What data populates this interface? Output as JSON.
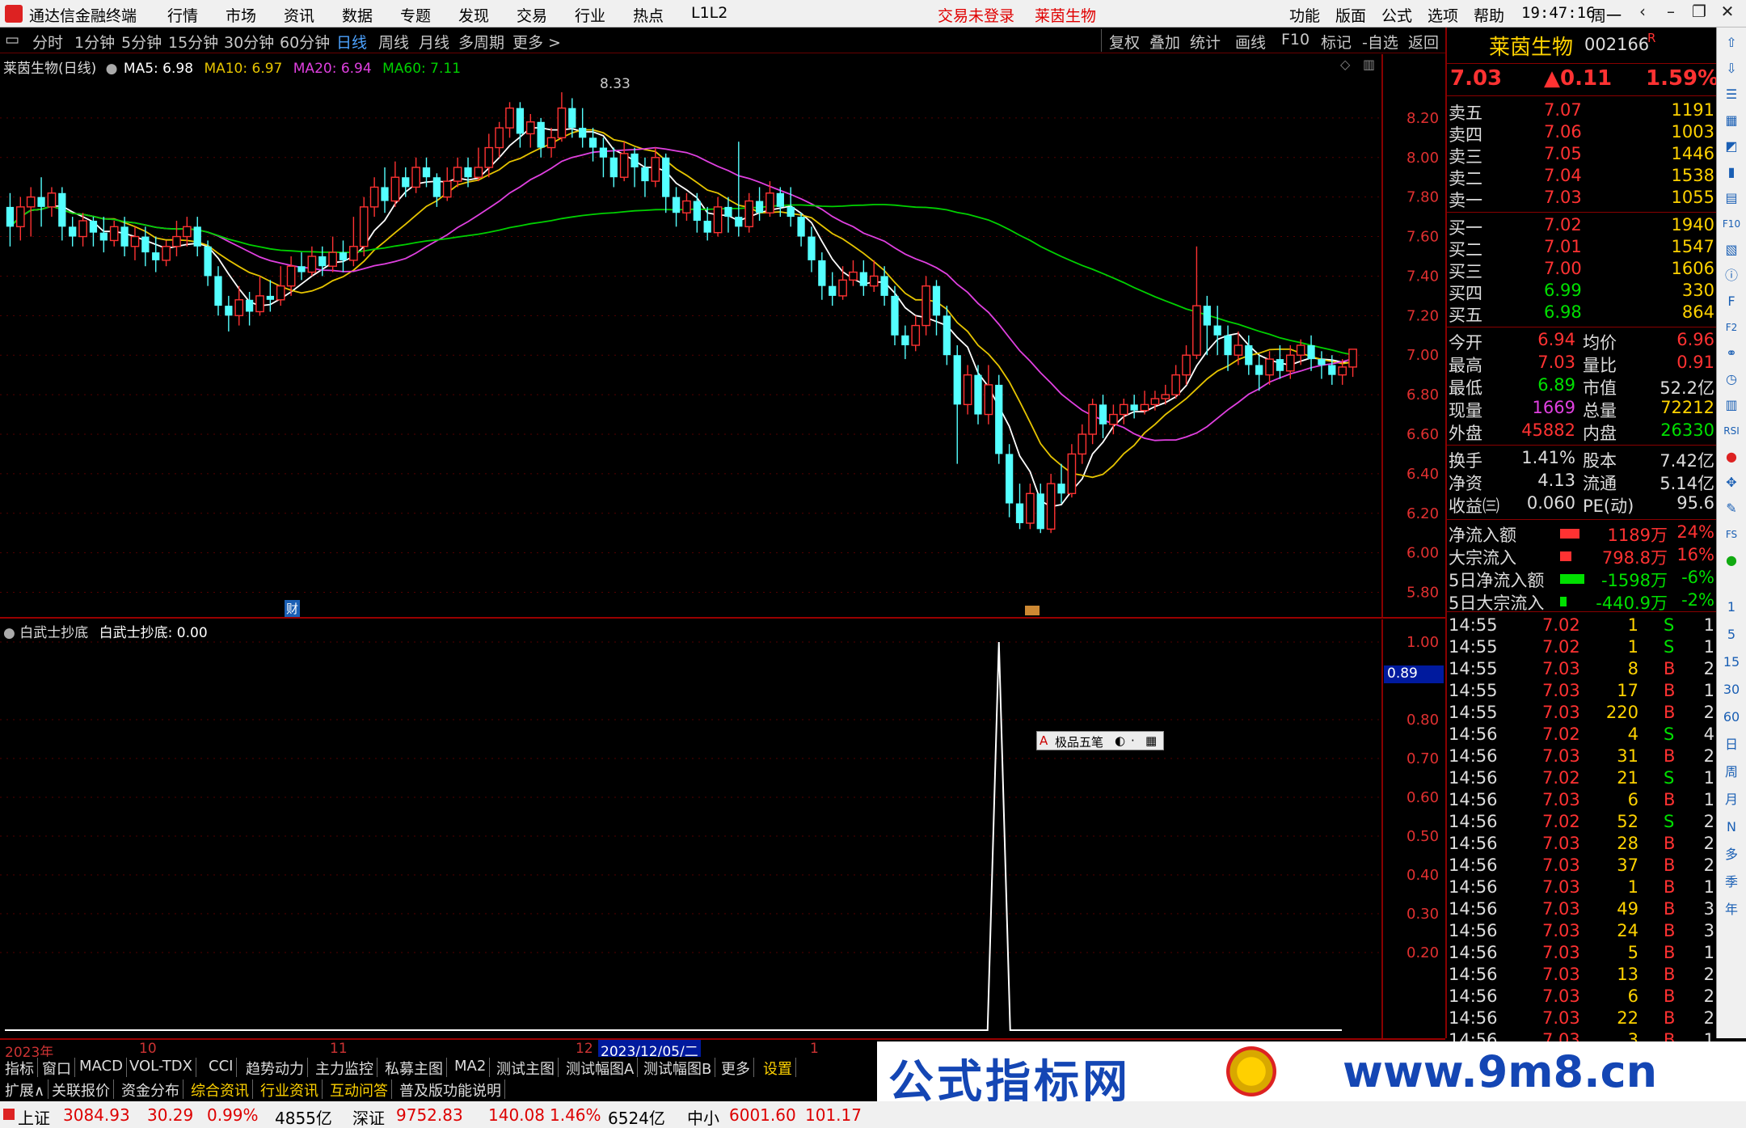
{
  "app": {
    "title": "通达信金融终端",
    "menu": [
      "行情",
      "市场",
      "资讯",
      "数据",
      "专题",
      "发现",
      "交易",
      "行业",
      "热点",
      "L1L2"
    ],
    "center_status": "交易未登录",
    "center_stock": "莱茵生物",
    "right_menu": [
      "功能",
      "版面",
      "公式",
      "选项",
      "帮助"
    ],
    "clock": "19:47:16",
    "weekday": "周一"
  },
  "periods": [
    "分时",
    "1分钟",
    "5分钟",
    "15分钟",
    "30分钟",
    "60分钟",
    "日线",
    "周线",
    "月线",
    "多周期",
    "更多 >"
  ],
  "selected_period": "日线",
  "chart_tools": [
    "复权",
    "叠加",
    "统计",
    "画线",
    "F10",
    "标记",
    "-自选",
    "返回"
  ],
  "main_legend": {
    "name": "莱茵生物(日线)",
    "ma5": "MA5: 6.98",
    "ma10": "MA10: 6.97",
    "ma20": "MA20: 6.94",
    "ma60": "MA60: 7.11"
  },
  "indicator_legend": {
    "name": "白武士抄底",
    "value": "白武士抄底: 0.00"
  },
  "high_marker": "8.33",
  "fin_marker": "财",
  "pop_tool": "极品五笔",
  "axis_value": "0.89",
  "date_axis": {
    "year": "2023年",
    "m10": "10",
    "m11": "11",
    "m12": "12",
    "cursor": "2023/12/05/二",
    "n1": "1"
  },
  "colors": {
    "up": "#ff3232",
    "down": "#54ffff",
    "ma5": "#ffffff",
    "ma10": "#e6c400",
    "ma20": "#e040e0",
    "ma60": "#00d000"
  },
  "chart_data": [
    {
      "type": "candlestick",
      "title": "莱茵生物(日线)",
      "y_ticks": [
        "8.20",
        "8.00",
        "7.80",
        "7.60",
        "7.40",
        "7.20",
        "7.00",
        "6.80",
        "6.60",
        "6.40",
        "6.20",
        "6.00",
        "5.80"
      ],
      "ylim": [
        5.7,
        8.4
      ],
      "candles": [
        [
          7.75,
          7.65,
          7.82,
          7.55
        ],
        [
          7.65,
          7.75,
          7.8,
          7.58
        ],
        [
          7.75,
          7.8,
          7.85,
          7.6
        ],
        [
          7.8,
          7.75,
          7.9,
          7.65
        ],
        [
          7.75,
          7.82,
          7.85,
          7.7
        ],
        [
          7.82,
          7.65,
          7.85,
          7.58
        ],
        [
          7.65,
          7.6,
          7.7,
          7.55
        ],
        [
          7.6,
          7.68,
          7.72,
          7.55
        ],
        [
          7.68,
          7.62,
          7.7,
          7.55
        ],
        [
          7.62,
          7.58,
          7.7,
          7.52
        ],
        [
          7.58,
          7.65,
          7.68,
          7.55
        ],
        [
          7.65,
          7.55,
          7.7,
          7.5
        ],
        [
          7.55,
          7.6,
          7.65,
          7.48
        ],
        [
          7.6,
          7.52,
          7.65,
          7.45
        ],
        [
          7.52,
          7.48,
          7.6,
          7.42
        ],
        [
          7.48,
          7.55,
          7.58,
          7.45
        ],
        [
          7.55,
          7.6,
          7.68,
          7.5
        ],
        [
          7.6,
          7.65,
          7.7,
          7.55
        ],
        [
          7.65,
          7.55,
          7.7,
          7.5
        ],
        [
          7.55,
          7.4,
          7.58,
          7.35
        ],
        [
          7.4,
          7.25,
          7.45,
          7.2
        ],
        [
          7.25,
          7.2,
          7.3,
          7.12
        ],
        [
          7.2,
          7.28,
          7.35,
          7.15
        ],
        [
          7.28,
          7.22,
          7.32,
          7.15
        ],
        [
          7.22,
          7.3,
          7.4,
          7.2
        ],
        [
          7.3,
          7.28,
          7.38,
          7.22
        ],
        [
          7.28,
          7.35,
          7.45,
          7.25
        ],
        [
          7.35,
          7.45,
          7.5,
          7.3
        ],
        [
          7.45,
          7.42,
          7.52,
          7.38
        ],
        [
          7.42,
          7.5,
          7.55,
          7.4
        ],
        [
          7.5,
          7.45,
          7.55,
          7.4
        ],
        [
          7.45,
          7.52,
          7.6,
          7.42
        ],
        [
          7.52,
          7.48,
          7.58,
          7.42
        ],
        [
          7.48,
          7.55,
          7.7,
          7.45
        ],
        [
          7.55,
          7.75,
          7.8,
          7.5
        ],
        [
          7.75,
          7.85,
          7.9,
          7.7
        ],
        [
          7.85,
          7.78,
          7.95,
          7.72
        ],
        [
          7.78,
          7.9,
          7.98,
          7.75
        ],
        [
          7.9,
          7.85,
          7.95,
          7.8
        ],
        [
          7.85,
          7.95,
          8.0,
          7.82
        ],
        [
          7.95,
          7.9,
          8.0,
          7.85
        ],
        [
          7.9,
          7.8,
          7.92,
          7.75
        ],
        [
          7.8,
          7.88,
          7.95,
          7.78
        ],
        [
          7.88,
          7.95,
          8.0,
          7.85
        ],
        [
          7.95,
          7.9,
          8.0,
          7.85
        ],
        [
          7.9,
          7.95,
          8.05,
          7.88
        ],
        [
          7.95,
          8.05,
          8.12,
          7.9
        ],
        [
          8.05,
          8.15,
          8.18,
          8.0
        ],
        [
          8.15,
          8.25,
          8.28,
          8.1
        ],
        [
          8.25,
          8.12,
          8.28,
          8.05
        ],
        [
          8.12,
          8.18,
          8.22,
          8.05
        ],
        [
          8.18,
          8.05,
          8.2,
          8.0
        ],
        [
          8.05,
          8.1,
          8.15,
          8.0
        ],
        [
          8.1,
          8.25,
          8.33,
          8.08
        ],
        [
          8.25,
          8.15,
          8.3,
          8.1
        ],
        [
          8.15,
          8.1,
          8.25,
          8.05
        ],
        [
          8.1,
          8.05,
          8.15,
          7.98
        ],
        [
          8.05,
          8.0,
          8.1,
          7.9
        ],
        [
          8.0,
          7.9,
          8.05,
          7.85
        ],
        [
          7.9,
          8.02,
          8.08,
          7.88
        ],
        [
          8.02,
          7.95,
          8.05,
          7.85
        ],
        [
          7.95,
          7.88,
          8.0,
          7.8
        ],
        [
          7.88,
          8.0,
          8.05,
          7.85
        ],
        [
          8.0,
          7.8,
          8.02,
          7.72
        ],
        [
          7.8,
          7.72,
          7.85,
          7.65
        ],
        [
          7.72,
          7.78,
          7.82,
          7.68
        ],
        [
          7.78,
          7.68,
          7.82,
          7.62
        ],
        [
          7.68,
          7.62,
          7.75,
          7.58
        ],
        [
          7.62,
          7.75,
          7.8,
          7.6
        ],
        [
          7.75,
          7.7,
          7.8,
          7.62
        ],
        [
          7.7,
          7.65,
          8.08,
          7.6
        ],
        [
          7.65,
          7.78,
          7.82,
          7.62
        ],
        [
          7.78,
          7.72,
          7.85,
          7.68
        ],
        [
          7.72,
          7.82,
          7.88,
          7.7
        ],
        [
          7.82,
          7.75,
          7.85,
          7.7
        ],
        [
          7.75,
          7.7,
          7.85,
          7.65
        ],
        [
          7.7,
          7.6,
          7.72,
          7.55
        ],
        [
          7.6,
          7.48,
          7.65,
          7.42
        ],
        [
          7.48,
          7.35,
          7.52,
          7.28
        ],
        [
          7.35,
          7.3,
          7.42,
          7.25
        ],
        [
          7.3,
          7.38,
          7.45,
          7.28
        ],
        [
          7.38,
          7.42,
          7.48,
          7.35
        ],
        [
          7.42,
          7.35,
          7.48,
          7.3
        ],
        [
          7.35,
          7.4,
          7.48,
          7.32
        ],
        [
          7.4,
          7.3,
          7.45,
          7.25
        ],
        [
          7.3,
          7.1,
          7.35,
          7.05
        ],
        [
          7.1,
          7.05,
          7.15,
          6.98
        ],
        [
          7.05,
          7.15,
          7.2,
          7.02
        ],
        [
          7.15,
          7.35,
          7.4,
          7.1
        ],
        [
          7.35,
          7.2,
          7.38,
          7.1
        ],
        [
          7.2,
          7.0,
          7.25,
          6.95
        ],
        [
          7.0,
          6.75,
          7.05,
          6.45
        ],
        [
          6.75,
          6.9,
          6.95,
          6.7
        ],
        [
          6.9,
          6.7,
          6.95,
          6.65
        ],
        [
          6.7,
          6.85,
          6.95,
          6.65
        ],
        [
          6.85,
          6.5,
          6.9,
          6.45
        ],
        [
          6.5,
          6.25,
          6.55,
          6.18
        ],
        [
          6.25,
          6.15,
          6.35,
          6.12
        ],
        [
          6.15,
          6.3,
          6.35,
          6.12
        ],
        [
          6.3,
          6.12,
          6.35,
          6.1
        ],
        [
          6.12,
          6.35,
          6.4,
          6.1
        ],
        [
          6.35,
          6.3,
          6.45,
          6.25
        ],
        [
          6.3,
          6.5,
          6.55,
          6.28
        ],
        [
          6.5,
          6.6,
          6.65,
          6.45
        ],
        [
          6.6,
          6.75,
          6.78,
          6.55
        ],
        [
          6.75,
          6.65,
          6.8,
          6.58
        ],
        [
          6.65,
          6.7,
          6.75,
          6.6
        ],
        [
          6.7,
          6.75,
          6.78,
          6.65
        ],
        [
          6.75,
          6.72,
          6.8,
          6.68
        ],
        [
          6.72,
          6.75,
          6.82,
          6.7
        ],
        [
          6.75,
          6.78,
          6.82,
          6.72
        ],
        [
          6.78,
          6.8,
          6.85,
          6.75
        ],
        [
          6.8,
          6.9,
          6.95,
          6.78
        ],
        [
          6.9,
          7.0,
          7.05,
          6.85
        ],
        [
          7.0,
          7.25,
          7.55,
          6.98
        ],
        [
          7.25,
          7.15,
          7.3,
          7.0
        ],
        [
          7.15,
          7.1,
          7.25,
          7.0
        ],
        [
          7.1,
          7.0,
          7.15,
          6.92
        ],
        [
          7.0,
          7.05,
          7.12,
          6.95
        ],
        [
          7.05,
          6.95,
          7.1,
          6.9
        ],
        [
          6.95,
          6.9,
          7.0,
          6.82
        ],
        [
          6.9,
          6.98,
          7.02,
          6.85
        ],
        [
          6.98,
          6.92,
          7.05,
          6.88
        ],
        [
          6.92,
          7.0,
          7.05,
          6.88
        ],
        [
          7.0,
          7.05,
          7.08,
          6.95
        ],
        [
          7.05,
          6.98,
          7.1,
          6.92
        ],
        [
          6.98,
          6.95,
          7.02,
          6.88
        ],
        [
          6.95,
          6.9,
          7.0,
          6.85
        ],
        [
          6.9,
          6.94,
          6.98,
          6.85
        ],
        [
          6.94,
          7.03,
          7.03,
          6.89
        ]
      ]
    },
    {
      "type": "line",
      "title": "白武士抄底",
      "y_ticks": [
        "1.00",
        "0.80",
        "0.70",
        "0.60",
        "0.50",
        "0.40",
        "0.30",
        "0.20"
      ],
      "ylim": [
        0,
        1.0
      ],
      "spike_index": 95,
      "spike_value": 1.0
    }
  ],
  "quote": {
    "name": "莱茵生物",
    "code": "002166",
    "flag": "R",
    "price": "7.03",
    "change": "▲0.11",
    "pct": "1.59%",
    "asks": [
      [
        "卖五",
        "7.07",
        "1191"
      ],
      [
        "卖四",
        "7.06",
        "1003"
      ],
      [
        "卖三",
        "7.05",
        "1446"
      ],
      [
        "卖二",
        "7.04",
        "1538"
      ],
      [
        "卖一",
        "7.03",
        "1055"
      ]
    ],
    "bids": [
      [
        "买一",
        "7.02",
        "1940"
      ],
      [
        "买二",
        "7.01",
        "1547"
      ],
      [
        "买三",
        "7.00",
        "1606"
      ],
      [
        "买四",
        "6.99",
        "330"
      ],
      [
        "买五",
        "6.98",
        "864"
      ]
    ],
    "stats": [
      [
        "今开",
        "6.94",
        "均价",
        "6.96"
      ],
      [
        "最高",
        "7.03",
        "量比",
        "0.91"
      ],
      [
        "最低",
        "6.89",
        "市值",
        "52.2亿"
      ],
      [
        "现量",
        "1669",
        "总量",
        "72212"
      ],
      [
        "外盘",
        "45882",
        "内盘",
        "26330"
      ]
    ],
    "stats2": [
      [
        "换手",
        "1.41%",
        "股本",
        "7.42亿"
      ],
      [
        "净资",
        "4.13",
        "流通",
        "5.14亿"
      ],
      [
        "收益㈢",
        "0.060",
        "PE(动)",
        "95.6"
      ]
    ],
    "flows": [
      [
        "净流入额",
        "1189万",
        "24%"
      ],
      [
        "大宗流入",
        "798.8万",
        "16%"
      ],
      [
        "5日净流入额",
        "-1598万",
        "-6%"
      ],
      [
        "5日大宗流入",
        "-440.9万",
        "-2%"
      ]
    ]
  },
  "ticks": [
    [
      "14:55",
      "7.02",
      "1",
      "S",
      "1"
    ],
    [
      "14:55",
      "7.02",
      "1",
      "S",
      "1"
    ],
    [
      "14:55",
      "7.03",
      "8",
      "B",
      "2"
    ],
    [
      "14:55",
      "7.03",
      "17",
      "B",
      "1"
    ],
    [
      "14:55",
      "7.03",
      "220",
      "B",
      "2"
    ],
    [
      "14:56",
      "7.02",
      "4",
      "S",
      "4"
    ],
    [
      "14:56",
      "7.03",
      "31",
      "B",
      "2"
    ],
    [
      "14:56",
      "7.02",
      "21",
      "S",
      "1"
    ],
    [
      "14:56",
      "7.03",
      "6",
      "B",
      "1"
    ],
    [
      "14:56",
      "7.02",
      "52",
      "S",
      "2"
    ],
    [
      "14:56",
      "7.03",
      "28",
      "B",
      "2"
    ],
    [
      "14:56",
      "7.03",
      "37",
      "B",
      "2"
    ],
    [
      "14:56",
      "7.03",
      "1",
      "B",
      "1"
    ],
    [
      "14:56",
      "7.03",
      "49",
      "B",
      "3"
    ],
    [
      "14:56",
      "7.03",
      "24",
      "B",
      "3"
    ],
    [
      "14:56",
      "7.03",
      "5",
      "B",
      "1"
    ],
    [
      "14:56",
      "7.03",
      "13",
      "B",
      "2"
    ],
    [
      "14:56",
      "7.03",
      "6",
      "B",
      "2"
    ],
    [
      "14:56",
      "7.03",
      "22",
      "B",
      "2"
    ],
    [
      "14:56",
      "7.03",
      "3",
      "B",
      "1"
    ]
  ],
  "tabs1": [
    "指标",
    "窗口",
    "MACD",
    "VOL-TDX",
    "CCI",
    "趋势动力",
    "主力监控",
    "私募主图",
    "MA2",
    "测试主图",
    "测试幅图A",
    "测试幅图B",
    "更多",
    "设置"
  ],
  "tabs2": [
    "扩展∧",
    "关联报价",
    "资金分布",
    "综合资讯",
    "行业资讯",
    "互动问答",
    "普及版功能说明"
  ],
  "status": {
    "sh_name": "上证",
    "sh_val": "3084.93",
    "sh_chg": "30.29",
    "sh_pct": "0.99%",
    "sh_amt": "4855亿",
    "sz_name": "深证",
    "sz_val": "9752.83",
    "sz_chg": "140.08",
    "sz_pct": "1.46%",
    "sz_amt": "6524亿",
    "zx_name": "中小",
    "zx_val": "6001.60",
    "zx_chg": "101.17"
  },
  "banner": {
    "text": "公式指标网",
    "url": "www.9m8.cn"
  },
  "toolbar_icons": [
    "up-arrow-icon",
    "down-arrow-icon",
    "list-icon",
    "grid-icon",
    "chart-icon",
    "candle-icon",
    "table-icon",
    "f10-icon",
    "doc-icon",
    "info-icon",
    "f-icon",
    "f2-icon",
    "link-icon",
    "clock-icon",
    "bar-icon",
    "rsi-icon",
    "red-icon",
    "dpad-icon",
    "pen-icon",
    "fs-icon",
    "green-icon"
  ],
  "toolbar_labels": [
    "1",
    "5",
    "15",
    "30",
    "60",
    "日",
    "周",
    "月",
    "N",
    "多",
    "季",
    "年"
  ]
}
